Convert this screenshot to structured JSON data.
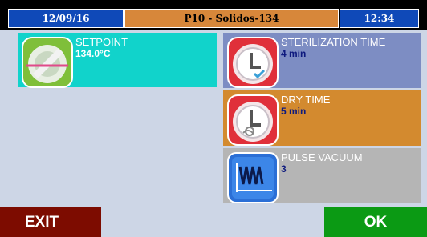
{
  "header": {
    "date": "12/09/16",
    "program": "P10 - Solidos-134",
    "time": "12:34"
  },
  "tiles": {
    "setpoint": {
      "label": "SETPOINT",
      "value": "134.0°C",
      "icon": "thermometer-icon"
    },
    "sterilization_time": {
      "label": "STERILIZATION TIME",
      "value": "4 min",
      "icon": "clock-check-icon"
    },
    "dry_time": {
      "label": "DRY TIME",
      "value": "5 min",
      "icon": "clock-dry-icon"
    },
    "pulse_vacuum": {
      "label": "PULSE VACUUM",
      "value": "3",
      "icon": "pulse-wave-icon"
    }
  },
  "buttons": {
    "exit": "EXIT",
    "ok": "OK"
  },
  "colors": {
    "header_blue": "#0f49b8",
    "header_orange": "#d7873a",
    "setpoint_tile": "#11d3cb",
    "sterilization_tile": "#7d8dc3",
    "dry_tile": "#d38a2f",
    "pulse_tile": "#b5b5b5",
    "exit_button": "#7d0c00",
    "ok_button": "#0b9a14",
    "background": "#cdd6e6"
  }
}
